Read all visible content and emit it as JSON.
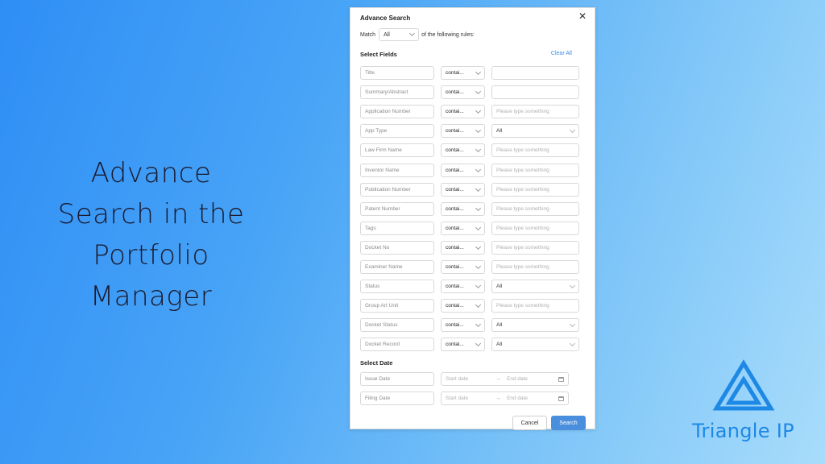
{
  "hero": {
    "lines": [
      "Advance",
      "Search in the",
      "Portfolio",
      "Manager"
    ]
  },
  "brand": {
    "name": "Triangle IP",
    "color": "#1e88e5"
  },
  "modal": {
    "title": "Advance Search",
    "match_label": "Match",
    "match_value": "All",
    "match_suffix": "of the following rules:",
    "select_fields_title": "Select Fields",
    "clear_all_label": "Clear All",
    "select_date_title": "Select Date",
    "fields": [
      {
        "name": "Title",
        "operator": "contai...",
        "value": ""
      },
      {
        "name": "Summary/Abstract",
        "operator": "contai...",
        "value": ""
      },
      {
        "name": "Application Number",
        "operator": "contai...",
        "value": "Please type something"
      },
      {
        "name": "App Type",
        "operator": "contai...",
        "value": "All"
      },
      {
        "name": "Law Firm Name",
        "operator": "contai...",
        "value": "Please type something"
      },
      {
        "name": "Inventor Name",
        "operator": "contai...",
        "value": "Please type something"
      },
      {
        "name": "Publication Number",
        "operator": "contai...",
        "value": "Please type something"
      },
      {
        "name": "Patent Number",
        "operator": "contai...",
        "value": "Please type something"
      },
      {
        "name": "Tags",
        "operator": "contai...",
        "value": "Please type something"
      },
      {
        "name": "Docket No",
        "operator": "contai...",
        "value": "Please type something"
      },
      {
        "name": "Examiner Name",
        "operator": "contai...",
        "value": "Please type something"
      },
      {
        "name": "Status",
        "operator": "contai...",
        "value": "All"
      },
      {
        "name": "Group Art Unit",
        "operator": "contai...",
        "value": "Please type something"
      },
      {
        "name": "Docket Status",
        "operator": "contai...",
        "value": "All"
      },
      {
        "name": "Docket Record",
        "operator": "contai...",
        "value": "All"
      }
    ],
    "dates": [
      {
        "name": "Issue Date",
        "start": "Start date",
        "arrow": "→",
        "end": "End date"
      },
      {
        "name": "Filing Date",
        "start": "Start date",
        "arrow": "→",
        "end": "End date"
      }
    ],
    "cancel_label": "Cancel",
    "search_label": "Search",
    "accent_color": "#4a8fde"
  }
}
